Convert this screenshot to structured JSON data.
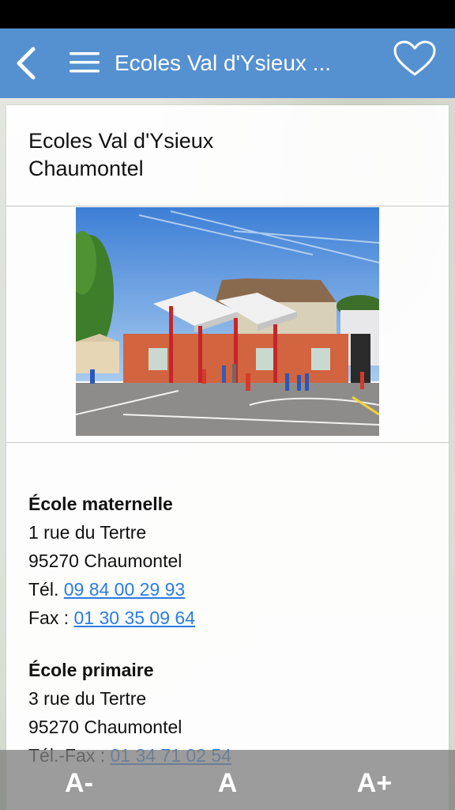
{
  "nav": {
    "title": "Ecoles Val d'Ysieux ...",
    "back_icon": "chevron-left-icon",
    "menu_icon": "hamburger-menu-icon",
    "favorite_icon": "heart-outline-icon",
    "color": "#5590d1"
  },
  "card": {
    "title_line1": "Ecoles Val d'Ysieux",
    "title_line2": "Chaumontel",
    "photo": "school-building-photo"
  },
  "maternelle": {
    "heading": "École maternelle",
    "address": "1 rue du Tertre",
    "city": "95270 Chaumontel",
    "tel_label": "Tél.",
    "tel": "09 84 00 29 93",
    "fax_label": "Fax :",
    "fax": "01 30 35 09 64"
  },
  "primaire": {
    "heading": "École primaire",
    "address": "3 rue du Tertre",
    "city": "95270 Chaumontel",
    "telfax_label": "Tél.-Fax :",
    "telfax": "01 34 71 02 54"
  },
  "font_bar": {
    "decrease": "A-",
    "normal": "A",
    "increase": "A+"
  },
  "colors": {
    "link": "#2a7de1",
    "nav_bar": "#5590d1"
  }
}
